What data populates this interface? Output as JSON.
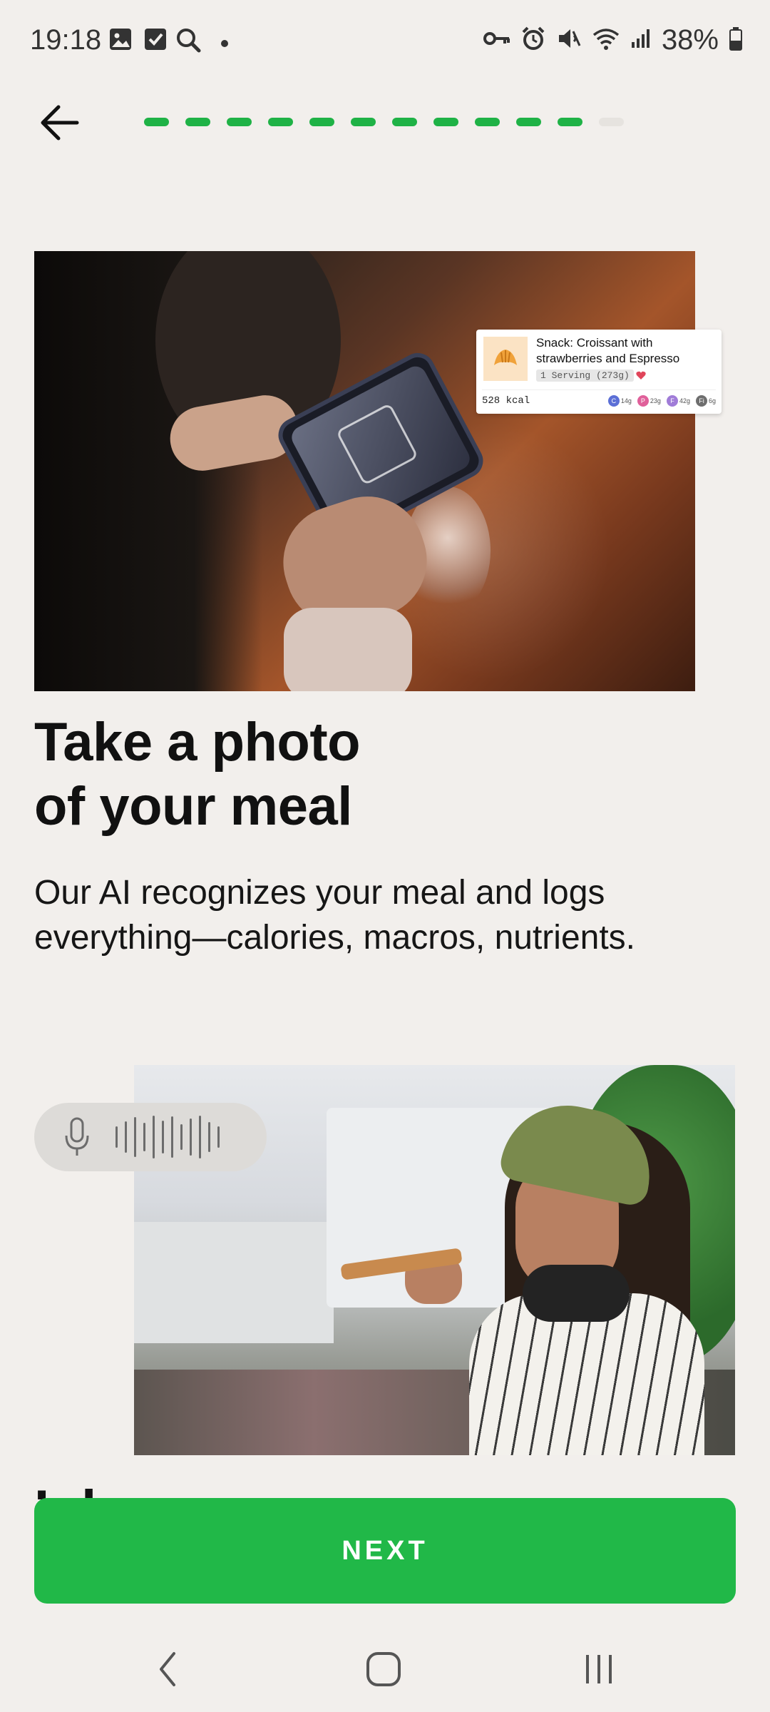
{
  "status_bar": {
    "time": "19:18",
    "battery": "38%",
    "left_icons": [
      "gallery-icon",
      "checkbox-icon",
      "search-icon",
      "dot-icon"
    ],
    "right_icons": [
      "key-icon",
      "alarm-icon",
      "mute-icon",
      "wifi-icon",
      "signal-icon",
      "battery-icon"
    ]
  },
  "nav": {
    "back_icon": "arrow-left-icon",
    "progress": {
      "total_steps": 12,
      "completed_steps": 11,
      "active_color": "#1fb246",
      "inactive_color": "#e6e3df"
    }
  },
  "meal_card": {
    "title": "Snack: Croissant with strawberries and Espresso",
    "serving": "1 Serving (273g)",
    "kcal": "528 kcal",
    "thumb_icon": "croissant-icon",
    "macros": [
      {
        "letter": "C",
        "value": "14g",
        "color": "#5b6fd6"
      },
      {
        "letter": "P",
        "value": "23g",
        "color": "#e0609a"
      },
      {
        "letter": "F",
        "value": "42g",
        "color": "#a07cd8"
      },
      {
        "letter": "Fi",
        "value": "6g",
        "color": "#6e6e6e"
      }
    ]
  },
  "feature": {
    "headline_line1": "Take a photo",
    "headline_line2": "of your meal",
    "description": "Our AI recognizes your meal and logs everything—calories, macros, nutrients."
  },
  "voice_pill": {
    "icon": "microphone-icon"
  },
  "next_heading_partial": "L           l",
  "next_button": {
    "label": "NEXT",
    "color": "#21b848"
  },
  "system_nav": {
    "back": "nav-back-icon",
    "home": "nav-home-icon",
    "recents": "nav-recents-icon"
  }
}
